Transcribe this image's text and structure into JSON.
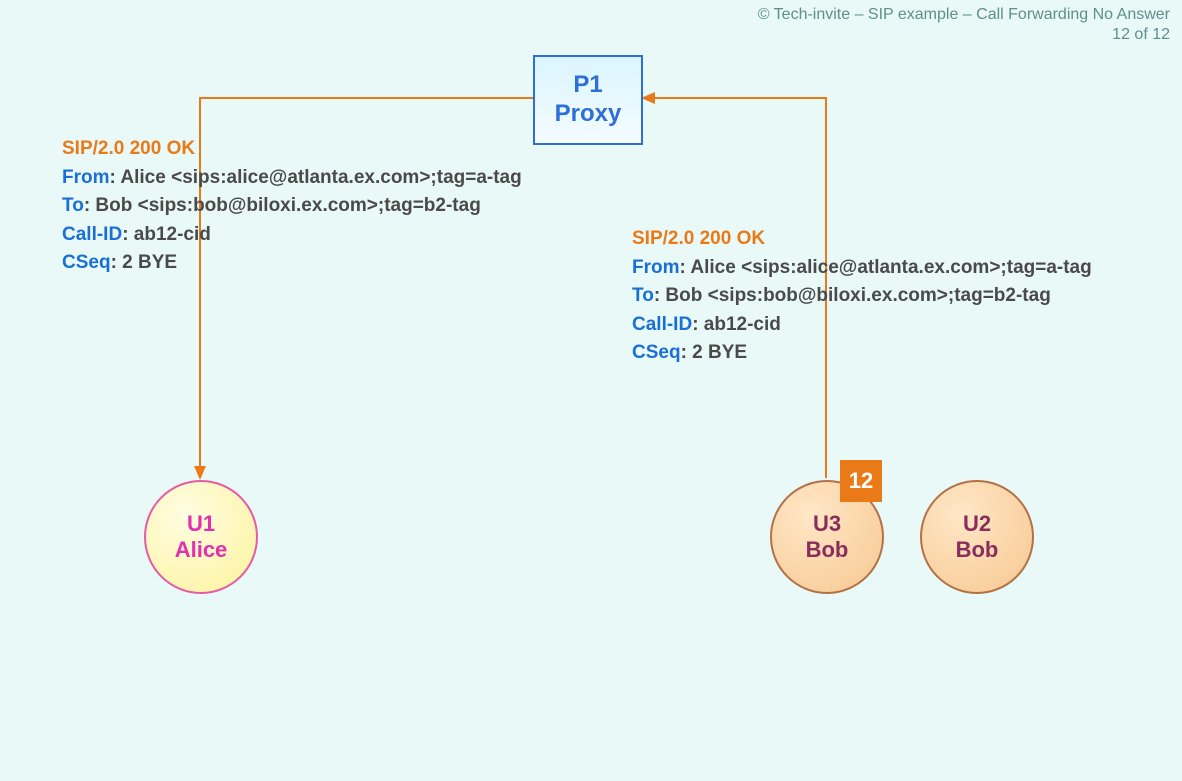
{
  "header": {
    "line1": "© Tech-invite – SIP example – Call Forwarding No Answer",
    "line2": "12 of 12"
  },
  "proxy": {
    "line1": "P1",
    "line2": "Proxy"
  },
  "nodes": {
    "alice": {
      "line1": "U1",
      "line2": "Alice"
    },
    "u3": {
      "line1": "U3",
      "line2": "Bob"
    },
    "u2": {
      "line1": "U2",
      "line2": "Bob"
    }
  },
  "badge": "12",
  "msg_left": {
    "status": "SIP/2.0 200 OK",
    "from_key": "From",
    "from_val": ": Alice <sips:alice@atlanta.ex.com>;tag=a-tag",
    "to_key": "To",
    "to_val": ": Bob <sips:bob@biloxi.ex.com>;tag=b2-tag",
    "callid_key": "Call-ID",
    "callid_val": ": ab12-cid",
    "cseq_key": "CSeq",
    "cseq_val": ": 2 BYE"
  },
  "msg_right": {
    "status": "SIP/2.0 200 OK",
    "from_key": "From",
    "from_val": ": Alice <sips:alice@atlanta.ex.com>;tag=a-tag",
    "to_key": "To",
    "to_val": ": Bob <sips:bob@biloxi.ex.com>;tag=b2-tag",
    "callid_key": "Call-ID",
    "callid_val": ": ab12-cid",
    "cseq_key": "CSeq",
    "cseq_val": ": 2 BYE"
  }
}
